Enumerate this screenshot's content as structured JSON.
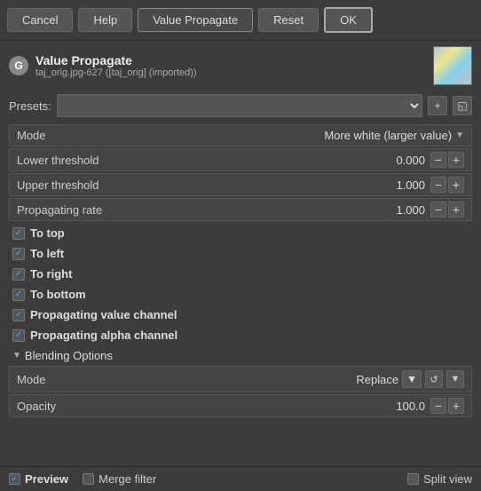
{
  "toolbar": {
    "cancel_label": "Cancel",
    "help_label": "Help",
    "title_label": "Value Propagate",
    "reset_label": "Reset",
    "ok_label": "OK"
  },
  "header": {
    "icon_letter": "G",
    "title": "Value Propagate",
    "subtitle": "taj_orig.jpg-627 ([taj_orig] (imported))"
  },
  "presets": {
    "label": "Presets:",
    "placeholder": "",
    "add_icon": "+",
    "save_icon": "💾"
  },
  "mode": {
    "label": "Mode",
    "value": "More white (larger value)"
  },
  "params": [
    {
      "label": "Lower threshold",
      "value": "0.000"
    },
    {
      "label": "Upper threshold",
      "value": "1.000"
    },
    {
      "label": "Propagating rate",
      "value": "1.000"
    }
  ],
  "checkboxes": [
    {
      "label": "To top",
      "checked": true
    },
    {
      "label": "To left",
      "checked": true
    },
    {
      "label": "To right",
      "checked": true
    },
    {
      "label": "To bottom",
      "checked": true
    },
    {
      "label": "Propagating value channel",
      "checked": true
    },
    {
      "label": "Propagating alpha channel",
      "checked": true
    }
  ],
  "blending": {
    "section_title": "Blending Options",
    "mode_label": "Mode",
    "mode_value": "Replace",
    "opacity_label": "Opacity",
    "opacity_value": "100.0"
  },
  "bottom": {
    "preview_label": "Preview",
    "merge_label": "Merge filter",
    "split_label": "Split view",
    "preview_checked": true,
    "merge_checked": false,
    "split_checked": false
  }
}
